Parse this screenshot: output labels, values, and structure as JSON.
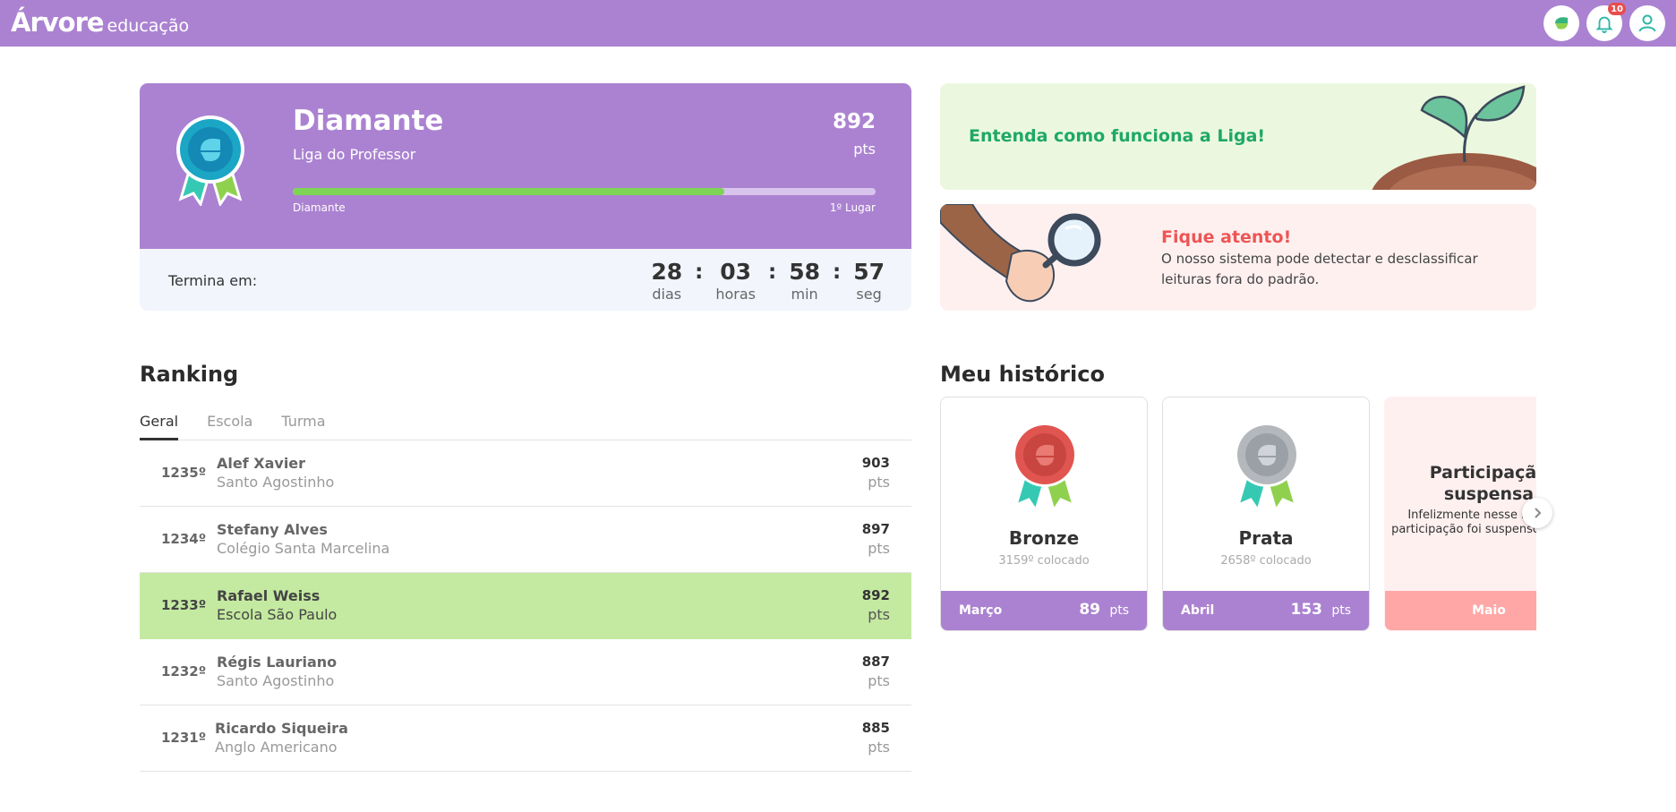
{
  "brand": {
    "name": "Árvore",
    "sub": "educação"
  },
  "header": {
    "notifications_count": "10",
    "icons": [
      "arvore-leaf-icon",
      "bell-icon",
      "user-icon"
    ]
  },
  "league": {
    "title": "Diamante",
    "subtitle": "Liga do Professor",
    "points": "892",
    "points_unit": "pts",
    "progress_fraction": 0.74,
    "progress_left": "Diamante",
    "progress_right": "1º Lugar",
    "ends_label": "Termina em:",
    "countdown": [
      {
        "value": "28",
        "label": "dias"
      },
      {
        "value": "03",
        "label": "horas"
      },
      {
        "value": "58",
        "label": "min"
      },
      {
        "value": "57",
        "label": "seg"
      }
    ]
  },
  "info": {
    "how_it_works": "Entenda como funciona a Liga!",
    "warning_title": "Fique atento!",
    "warning_text": "O nosso sistema pode detectar e desclassificar leituras fora do padrão."
  },
  "ranking": {
    "title": "Ranking",
    "tabs": [
      "Geral",
      "Escola",
      "Turma"
    ],
    "active_tab": "Geral",
    "rows": [
      {
        "pos": "1235º",
        "name": "Alef Xavier",
        "school": "Santo Agostinho",
        "pts": "903",
        "unit": "pts"
      },
      {
        "pos": "1234º",
        "name": "Stefany Alves",
        "school": "Colégio Santa Marcelina",
        "pts": "897",
        "unit": "pts"
      },
      {
        "pos": "1233º",
        "name": "Rafael Weiss",
        "school": "Escola São Paulo",
        "pts": "892",
        "unit": "pts"
      },
      {
        "pos": "1232º",
        "name": "Régis Lauriano",
        "school": "Santo Agostinho",
        "pts": "887",
        "unit": "pts"
      },
      {
        "pos": "1231º",
        "name": "Ricardo Siqueira",
        "school": "Anglo Americano",
        "pts": "885",
        "unit": "pts"
      }
    ]
  },
  "history": {
    "title": "Meu histórico",
    "cards": [
      {
        "name": "Bronze",
        "place": "3159º colocado",
        "month": "Março",
        "pts": "89",
        "unit": "pts"
      },
      {
        "name": "Prata",
        "place": "2658º colocado",
        "month": "Abril",
        "pts": "153",
        "unit": "pts"
      }
    ],
    "suspended": {
      "title": "Participação suspensa",
      "text": "Infelizmente nesse mês sua participação foi suspenso da liga.",
      "month": "Maio"
    }
  },
  "colors": {
    "primary": "#ab82d1",
    "green": "#7dd455",
    "highlight_row": "#c4eaa1",
    "warning": "#ee5555",
    "success_text": "#1ea868"
  }
}
